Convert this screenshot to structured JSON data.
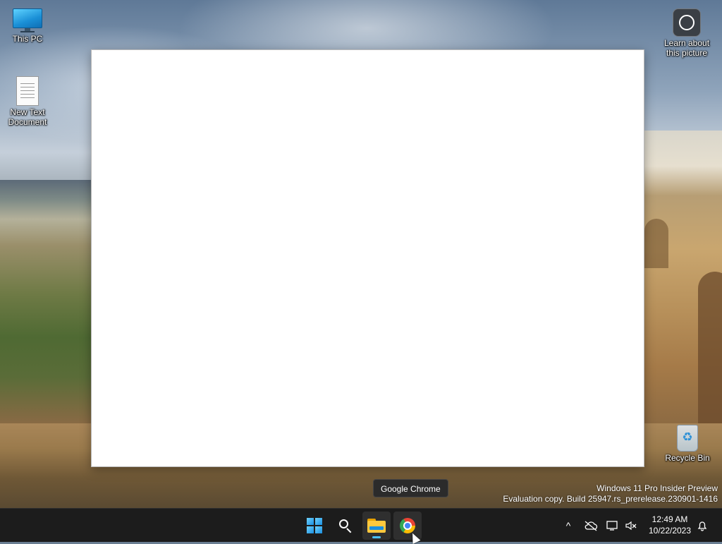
{
  "desktop": {
    "icons": [
      {
        "label": "This PC",
        "icon": "monitor-icon"
      },
      {
        "label": "New Text Document",
        "icon": "text-document-icon"
      },
      {
        "label": "Learn about this picture",
        "icon": "camera-info-icon"
      },
      {
        "label": "Recycle Bin",
        "icon": "recycle-bin-icon"
      }
    ],
    "watermark": {
      "line1": "Windows 11 Pro Insider Preview",
      "line2": "Evaluation copy. Build 25947.rs_prerelease.230901-1416"
    }
  },
  "tooltip": {
    "text": "Google Chrome"
  },
  "taskbar": {
    "apps": [
      {
        "name": "Start",
        "icon": "windows-start-icon"
      },
      {
        "name": "Search",
        "icon": "search-icon"
      },
      {
        "name": "File Explorer",
        "icon": "file-explorer-icon",
        "active": true
      },
      {
        "name": "Google Chrome",
        "icon": "chrome-icon",
        "hovered": true
      }
    ],
    "tray": {
      "overflow_chevron": "^",
      "clock_time": "12:49 AM",
      "clock_date": "10/22/2023"
    }
  },
  "colors": {
    "taskbar_bg": "#1c1c1c",
    "accent": "#4cc2ff"
  }
}
